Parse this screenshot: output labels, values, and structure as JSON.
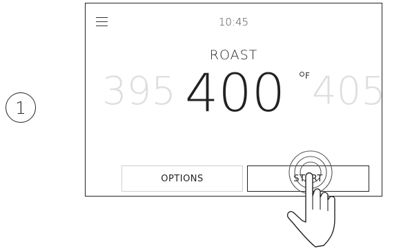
{
  "step": {
    "number": "1"
  },
  "screen": {
    "menu_icon": "hamburger-menu-icon",
    "clock": "10:45",
    "mode": "ROAST",
    "temperature": {
      "previous": "395",
      "current": "400",
      "next": "405",
      "unit": "F"
    },
    "buttons": {
      "options_label": "OPTIONS",
      "start_label": "START"
    }
  },
  "overlay": {
    "icon": "tap-hand-icon"
  }
}
